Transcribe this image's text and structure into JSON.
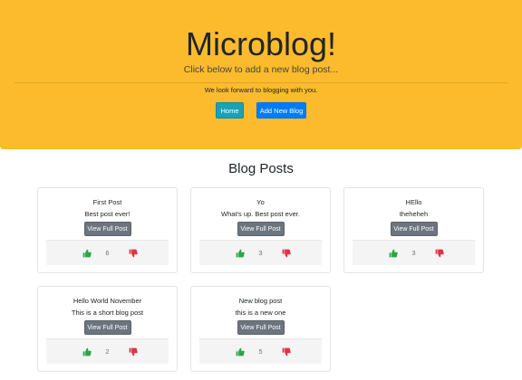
{
  "header": {
    "title": "Microblog!",
    "lead": "Click below to add a new blog post...",
    "text": "We look forward to blogging with you.",
    "home_button": "Home",
    "add_button": "Add New Blog",
    "colors": {
      "background": "#fcbb2c",
      "home_button": "#17a2b8",
      "add_button": "#007bff"
    }
  },
  "section": {
    "title": "Blog Posts"
  },
  "posts": [
    {
      "title": "First Post",
      "description": "Best post ever!",
      "button": "View Full Post",
      "votes": "6"
    },
    {
      "title": "Yo",
      "description": "What's up. Best post ever.",
      "button": "View Full Post",
      "votes": "3"
    },
    {
      "title": "HEllo",
      "description": "theheheh",
      "button": "View Full Post",
      "votes": "3"
    },
    {
      "title": "Hello World November",
      "description": "This is a short blog post",
      "button": "View Full Post",
      "votes": "2"
    },
    {
      "title": "New blog post",
      "description": "this is a new one",
      "button": "View Full Post",
      "votes": "5"
    }
  ],
  "icons": {
    "upvote": "thumbs-up-icon",
    "downvote": "thumbs-down-icon",
    "upvote_color": "#28a745",
    "downvote_color": "#dc3545"
  }
}
